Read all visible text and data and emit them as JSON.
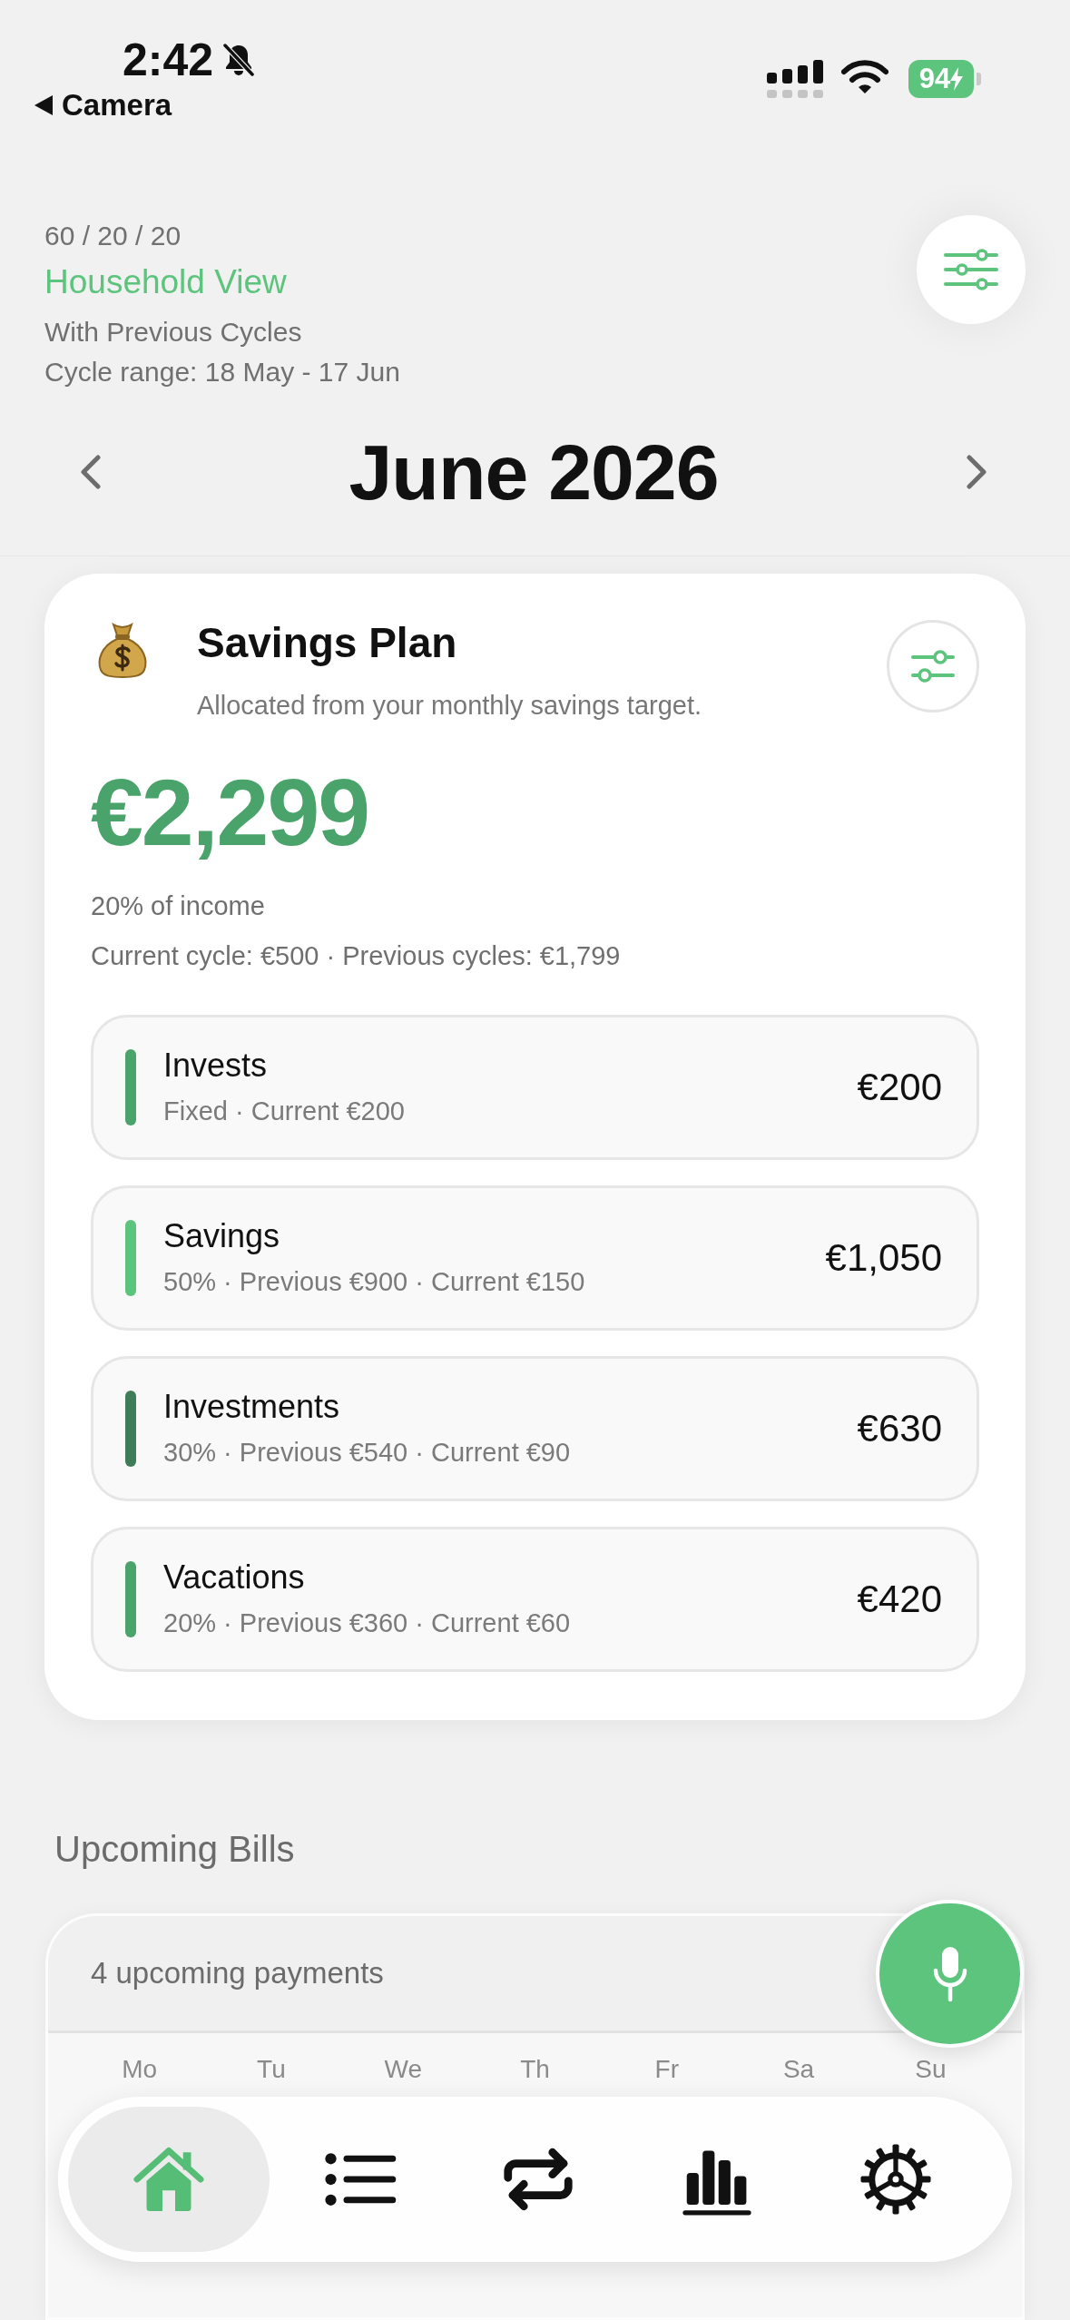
{
  "status_bar": {
    "time": "2:42",
    "silent": true,
    "back_label": "Camera",
    "battery": "94",
    "charging": true
  },
  "header": {
    "split": "60 / 20 / 20",
    "view": "Household View",
    "mode": "With Previous Cycles",
    "cycle_range": "Cycle range: 18 May - 17 Jun"
  },
  "month_nav": {
    "title": "June 2026"
  },
  "savings_plan": {
    "title": "Savings Plan",
    "subtitle": "Allocated from your monthly savings target.",
    "total": "€2,299",
    "share": "20% of income",
    "breakdown": "Current cycle: €500 · Previous cycles: €1,799",
    "allocations": [
      {
        "name": "Invests",
        "detail": "Fixed · Current €200",
        "amount": "€200",
        "color": "#4aa36a"
      },
      {
        "name": "Savings",
        "detail": "50% · Previous €900 · Current €150",
        "amount": "€1,050",
        "color": "#5cc47d"
      },
      {
        "name": "Investments",
        "detail": "30% · Previous €540 · Current €90",
        "amount": "€630",
        "color": "#3f7d59"
      },
      {
        "name": "Vacations",
        "detail": "20% · Previous €360 · Current €60",
        "amount": "€420",
        "color": "#4aa36a"
      }
    ]
  },
  "upcoming_bills": {
    "heading": "Upcoming Bills",
    "summary": "4 upcoming payments",
    "weekdays": [
      "Mo",
      "Tu",
      "We",
      "Th",
      "Fr",
      "Sa",
      "Su"
    ]
  },
  "bottom_nav": [
    {
      "kind": "home",
      "selected": true
    },
    {
      "kind": "list",
      "selected": false
    },
    {
      "kind": "transfers",
      "selected": false
    },
    {
      "kind": "stats",
      "selected": false
    },
    {
      "kind": "settings",
      "selected": false
    }
  ]
}
